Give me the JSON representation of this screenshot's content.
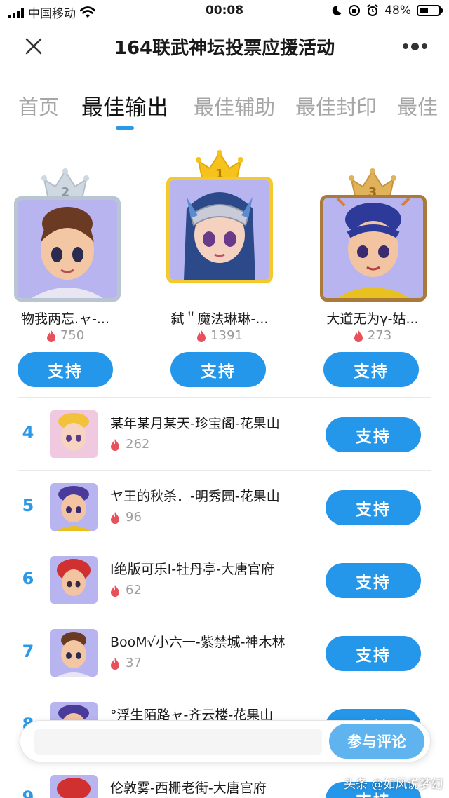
{
  "status_bar": {
    "carrier": "中国移动",
    "time": "00:08",
    "battery": "48%",
    "battery_level": 0.48
  },
  "nav": {
    "title": "164联武神坛投票应援活动"
  },
  "tabs": [
    {
      "label": "首页",
      "active": false
    },
    {
      "label": "最佳输出",
      "active": true
    },
    {
      "label": "最佳辅助",
      "active": false
    },
    {
      "label": "最佳封印",
      "active": false
    },
    {
      "label": "最佳",
      "active": false
    }
  ],
  "support_label": "支持",
  "podium": [
    {
      "rank": "2",
      "name": "物我两忘.ャ-...",
      "votes": "750",
      "crown_color": "#c9d3dc",
      "frame_color": "#b9c6d2"
    },
    {
      "rank": "1",
      "name": "弑＂魔法琳琳-...",
      "votes": "1391",
      "crown_color": "#f6c21c",
      "frame_color": "#f4c92e"
    },
    {
      "rank": "3",
      "name": "大道无为γ-姑...",
      "votes": "273",
      "crown_color": "#e0b25a",
      "frame_color": "#a97a3a"
    }
  ],
  "list": [
    {
      "rank": "4",
      "name": "某年某月某天-珍宝阁-花果山",
      "votes": "262"
    },
    {
      "rank": "5",
      "name": "ヤ王的秋杀．-明秀园-花果山",
      "votes": "96"
    },
    {
      "rank": "6",
      "name": "I绝版可乐I-牡丹亭-大唐官府",
      "votes": "62"
    },
    {
      "rank": "7",
      "name": "BooM√小六一-紫禁城-神木林",
      "votes": "37"
    },
    {
      "rank": "8",
      "name": "°浮生陌路ャ-齐云楼-花果山",
      "votes": ""
    },
    {
      "rank": "9",
      "name": "伦敦雾-西栅老街-大唐官府",
      "votes": ""
    }
  ],
  "comment": {
    "placeholder": "",
    "button_label": "参与评论"
  },
  "watermark": "头条 @如风说梦幻",
  "colors": {
    "accent": "#2497ea",
    "rank_text": "#2a9ae8",
    "flame": "#e8505b",
    "avatar_bg": "#b8b4f0"
  }
}
